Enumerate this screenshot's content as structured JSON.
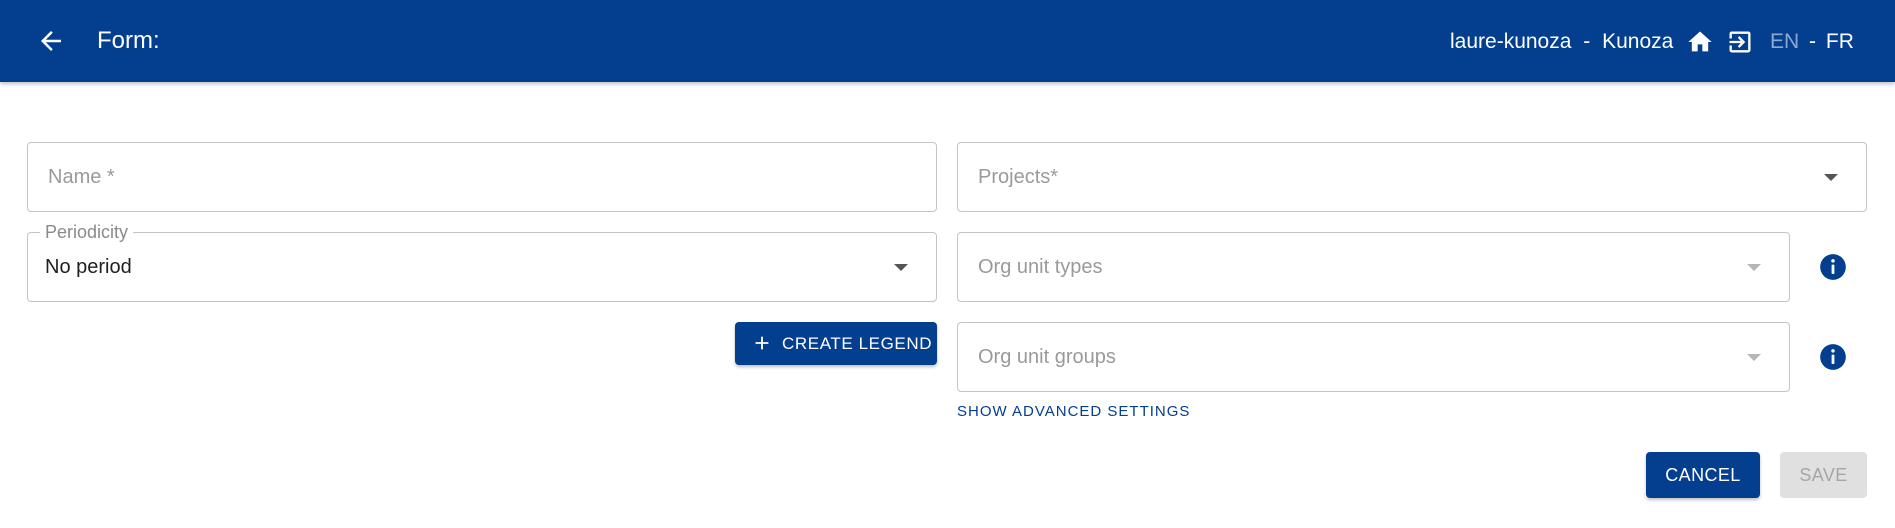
{
  "header": {
    "title": "Form:",
    "user_name": "laure-kunoza",
    "separator": "-",
    "user_account": "Kunoza",
    "lang_en": "EN",
    "lang_sep": "-",
    "lang_fr": "FR",
    "background_color": "#033e8f",
    "icons": [
      "arrow-back-icon",
      "home-icon",
      "logout-icon"
    ]
  },
  "form": {
    "name": {
      "placeholder": "Name *",
      "value": ""
    },
    "periodicity": {
      "label": "Periodicity",
      "value": "No period"
    },
    "projects": {
      "placeholder": "Projects*"
    },
    "org_unit_types": {
      "placeholder": "Org unit types"
    },
    "org_unit_groups": {
      "placeholder": "Org unit groups"
    },
    "info_icon": "info-icon"
  },
  "actions": {
    "create_legend": "CREATE LEGEND",
    "show_advanced": "SHOW ADVANCED SETTINGS",
    "cancel": "CANCEL",
    "save": "SAVE",
    "save_disabled": true
  },
  "colors": {
    "primary": "#033e8f",
    "lang_inactive": "#8ea9d1",
    "disabled_bg": "#e0e0e0"
  }
}
